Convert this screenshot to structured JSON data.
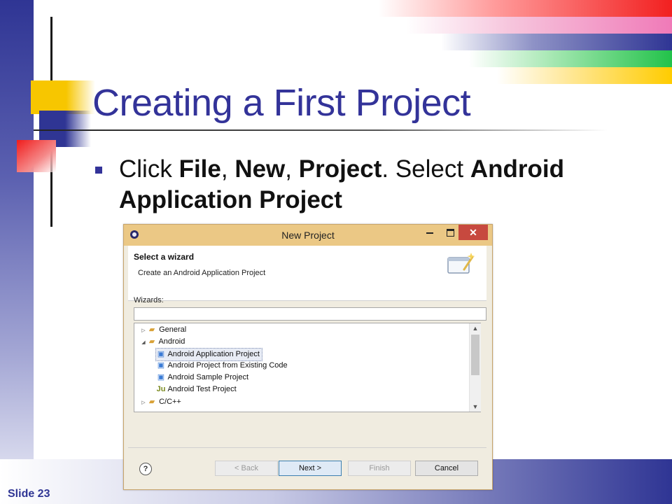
{
  "slide": {
    "title": "Creating a First Project",
    "bullet": {
      "t1": "Click ",
      "b1": "File",
      "t2": ", ",
      "b2": "New",
      "t3": ", ",
      "b3": "Project",
      "t4": ". Select ",
      "b4": "Android Application Project"
    },
    "slide_number": "Slide 23",
    "colors": {
      "title": "#333399",
      "accent_blue": "#2f3594",
      "accent_red": "#f01c1c",
      "accent_yellow": "#f7c600",
      "accent_green": "#22c24a"
    }
  },
  "dialog": {
    "window_title": "New Project",
    "close_glyph": "✕",
    "header": {
      "title": "Select a wizard",
      "description": "Create an Android Application Project"
    },
    "wizards_label": "Wizards:",
    "filter_value": "",
    "tree": [
      {
        "label": "General",
        "icon": "folder-icon",
        "expanded": false
      },
      {
        "label": "Android",
        "icon": "folder-icon",
        "expanded": true
      },
      {
        "label": "Android Application Project",
        "icon": "android-project-icon",
        "selected": true
      },
      {
        "label": "Android Project from Existing Code",
        "icon": "android-project-icon"
      },
      {
        "label": "Android Sample Project",
        "icon": "android-project-icon"
      },
      {
        "label": "Android Test Project",
        "icon": "junit-icon",
        "icon_text": "Ju"
      },
      {
        "label": "C/C++",
        "icon": "folder-icon",
        "expanded": false
      }
    ],
    "buttons": {
      "help": "?",
      "back": "< Back",
      "next": "Next >",
      "finish": "Finish",
      "cancel": "Cancel"
    },
    "colors": {
      "titlebar": "#ebc885",
      "close": "#c7493f"
    }
  }
}
